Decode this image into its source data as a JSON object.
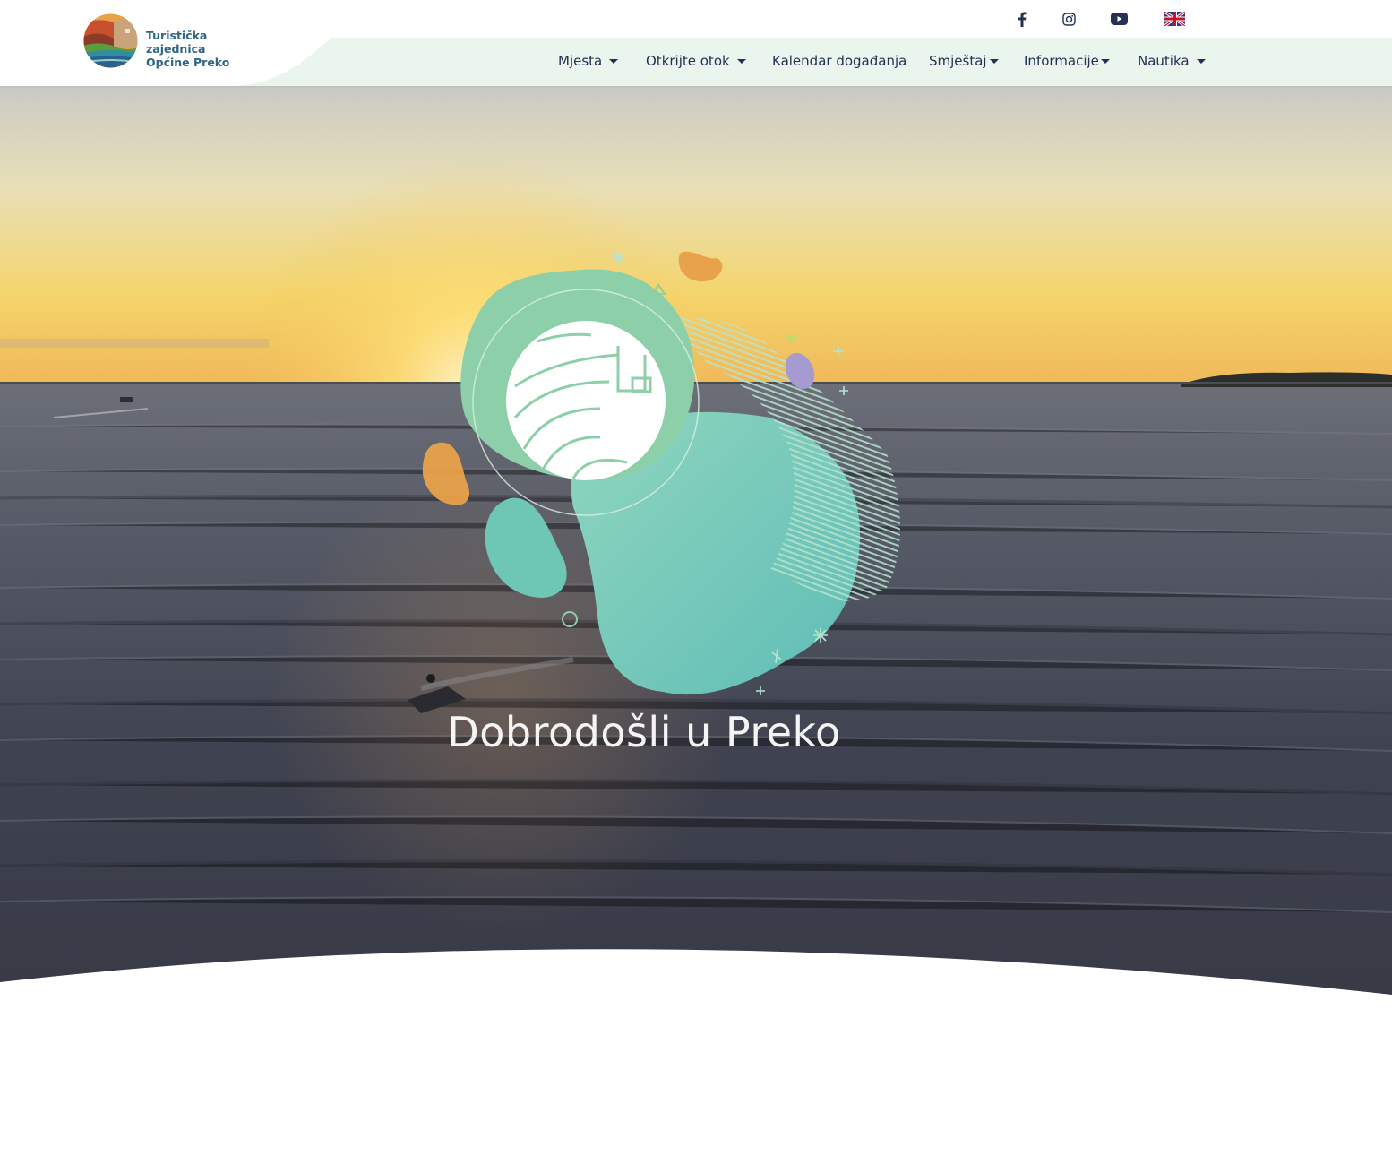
{
  "brand": {
    "line1": "Turistička zajednica",
    "line2": "Općine Preko",
    "text_color": "#2f6684"
  },
  "social": {
    "facebook_icon": "facebook-icon",
    "instagram_icon": "instagram-icon",
    "youtube_icon": "youtube-icon",
    "language_icon": "uk-flag-icon"
  },
  "nav": {
    "items": [
      {
        "label": "Mjesta",
        "dropdown": true
      },
      {
        "label": "Otkrijte otok",
        "dropdown": true
      },
      {
        "label": "Kalendar događanja",
        "dropdown": false
      },
      {
        "label": "Smještaj",
        "dropdown": true
      },
      {
        "label": "Informacije",
        "dropdown": true
      },
      {
        "label": "Nautika",
        "dropdown": true
      }
    ]
  },
  "hero": {
    "title": "Dobrodošli u Preko"
  },
  "colors": {
    "nav_text": "#243155",
    "nav_band": "#eaf5ee",
    "accent_teal": "#6cc4b5",
    "accent_green": "#8ccfa8",
    "accent_orange": "#e8a24a",
    "accent_purple": "#a59bd0"
  }
}
